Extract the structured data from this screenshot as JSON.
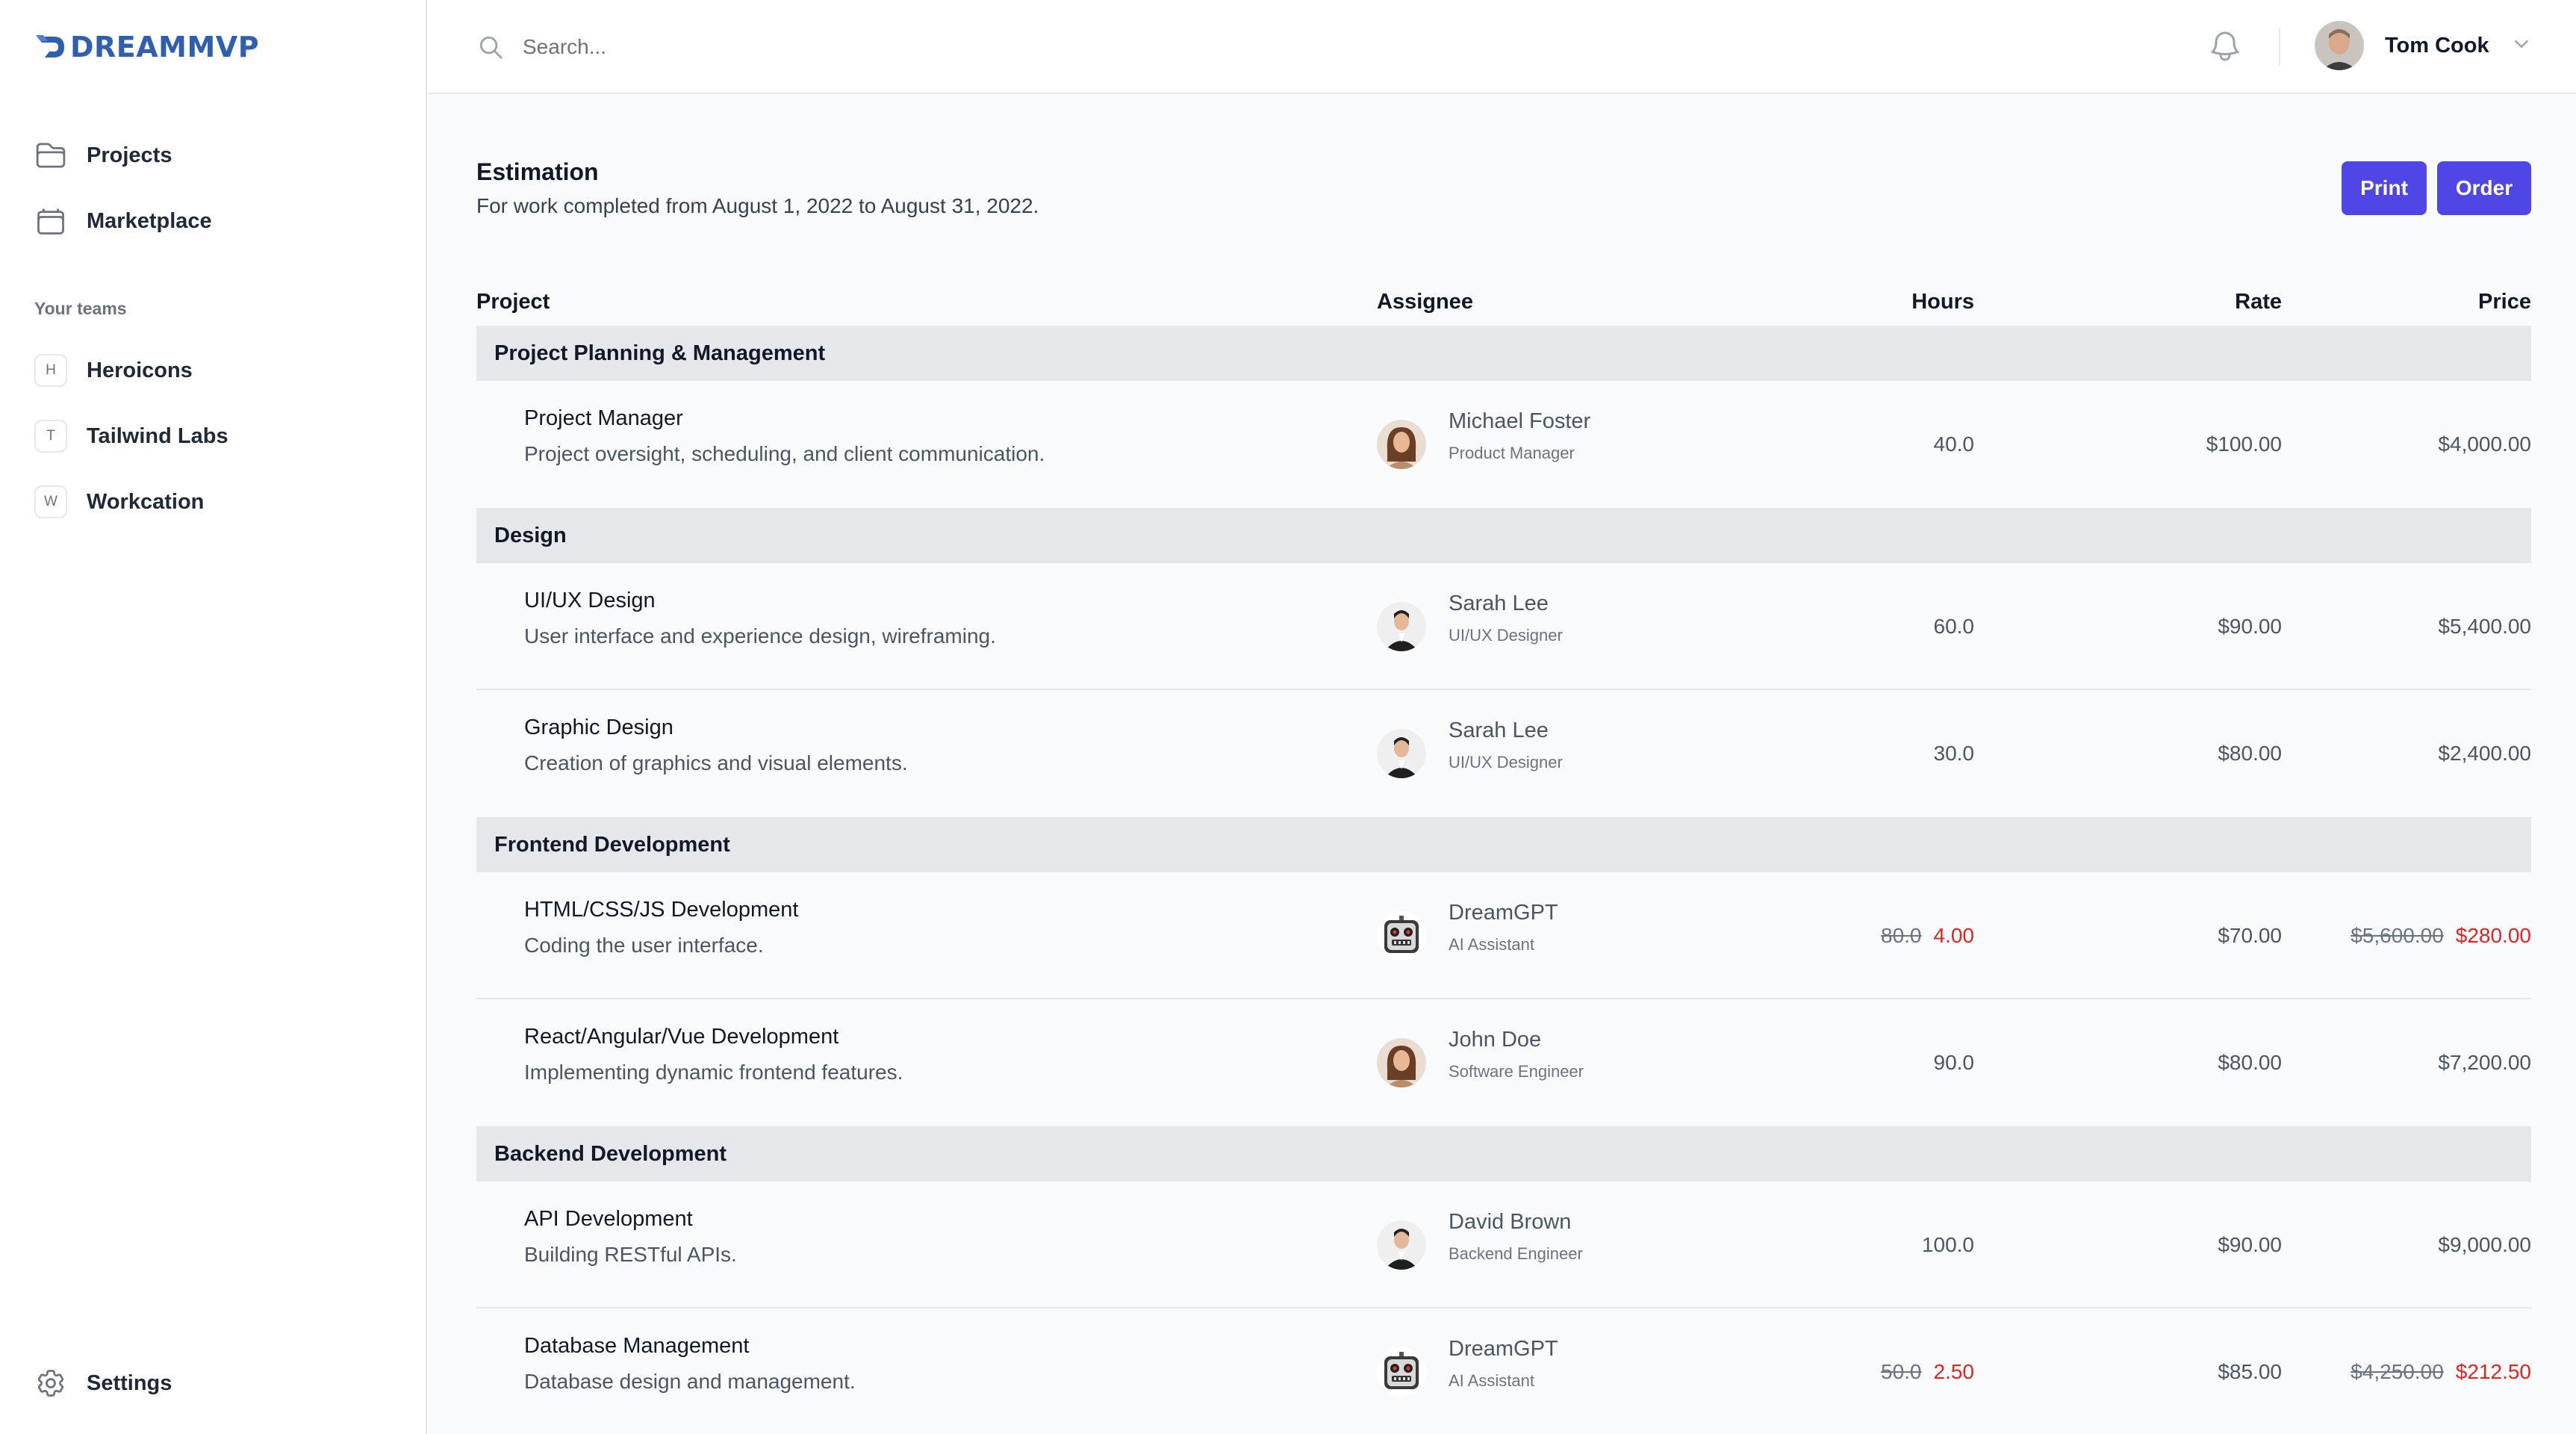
{
  "brand": {
    "name": "DREAMMVP",
    "color": "#2f5fb3"
  },
  "sidebar": {
    "nav": [
      {
        "label": "Projects",
        "icon": "folder-icon"
      },
      {
        "label": "Marketplace",
        "icon": "calendar-icon"
      }
    ],
    "teams_heading": "Your teams",
    "teams": [
      {
        "initial": "H",
        "label": "Heroicons"
      },
      {
        "initial": "T",
        "label": "Tailwind Labs"
      },
      {
        "initial": "W",
        "label": "Workcation"
      }
    ],
    "settings_label": "Settings"
  },
  "topbar": {
    "search_placeholder": "Search...",
    "user_name": "Tom Cook"
  },
  "page": {
    "title": "Estimation",
    "subtitle": "For work completed from August 1, 2022 to August 31, 2022.",
    "print_label": "Print",
    "order_label": "Order",
    "accent_color": "#4f46e5"
  },
  "table": {
    "headers": {
      "project": "Project",
      "assignee": "Assignee",
      "hours": "Hours",
      "rate": "Rate",
      "price": "Price"
    },
    "sections": [
      {
        "name": "Project Planning & Management",
        "items": [
          {
            "name": "Project Manager",
            "desc": "Project oversight, scheduling, and client communication.",
            "assignee": "Michael Foster",
            "role": "Product Manager",
            "avatar": "woman-avatar",
            "hours": "40.0",
            "hours_new": "",
            "rate": "$100.00",
            "price": "$4,000.00",
            "price_new": ""
          }
        ]
      },
      {
        "name": "Design",
        "items": [
          {
            "name": "UI/UX Design",
            "desc": "User interface and experience design, wireframing.",
            "assignee": "Sarah Lee",
            "role": "UI/UX Designer",
            "avatar": "man-suit-avatar",
            "hours": "60.0",
            "hours_new": "",
            "rate": "$90.00",
            "price": "$5,400.00",
            "price_new": ""
          },
          {
            "name": "Graphic Design",
            "desc": "Creation of graphics and visual elements.",
            "assignee": "Sarah Lee",
            "role": "UI/UX Designer",
            "avatar": "man-suit-avatar",
            "hours": "30.0",
            "hours_new": "",
            "rate": "$80.00",
            "price": "$2,400.00",
            "price_new": ""
          }
        ]
      },
      {
        "name": "Frontend Development",
        "items": [
          {
            "name": "HTML/CSS/JS Development",
            "desc": "Coding the user interface.",
            "assignee": "DreamGPT",
            "role": "AI Assistant",
            "avatar": "robot-avatar",
            "hours": "80.0",
            "hours_new": "4.00",
            "rate": "$70.00",
            "price": "$5,600.00",
            "price_new": "$280.00"
          },
          {
            "name": "React/Angular/Vue Development",
            "desc": "Implementing dynamic frontend features.",
            "assignee": "John Doe",
            "role": "Software Engineer",
            "avatar": "woman-avatar",
            "hours": "90.0",
            "hours_new": "",
            "rate": "$80.00",
            "price": "$7,200.00",
            "price_new": ""
          }
        ]
      },
      {
        "name": "Backend Development",
        "items": [
          {
            "name": "API Development",
            "desc": "Building RESTful APIs.",
            "assignee": "David Brown",
            "role": "Backend Engineer",
            "avatar": "man-suit-avatar",
            "hours": "100.0",
            "hours_new": "",
            "rate": "$90.00",
            "price": "$9,000.00",
            "price_new": ""
          },
          {
            "name": "Database Management",
            "desc": "Database design and management.",
            "assignee": "DreamGPT",
            "role": "AI Assistant",
            "avatar": "robot-avatar",
            "hours": "50.0",
            "hours_new": "2.50",
            "rate": "$85.00",
            "price": "$4,250.00",
            "price_new": "$212.50"
          }
        ]
      }
    ]
  }
}
